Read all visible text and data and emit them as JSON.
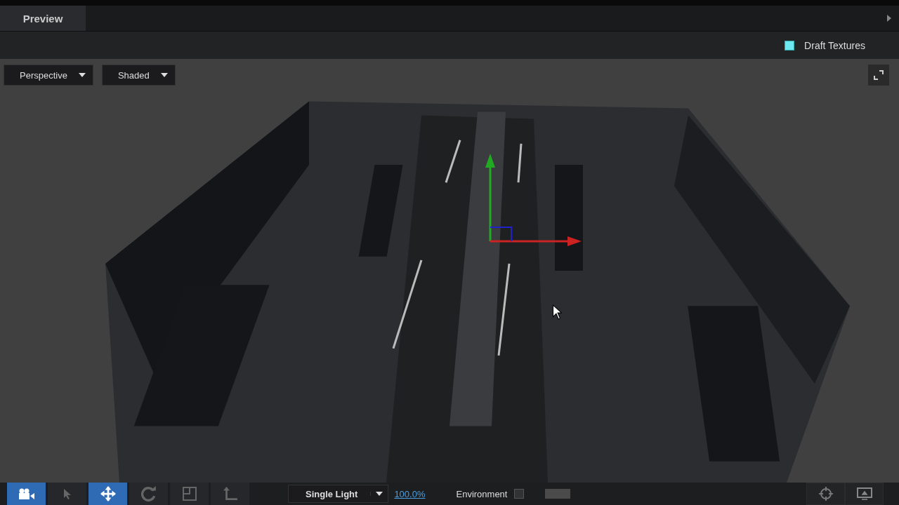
{
  "panel": {
    "title": "Preview"
  },
  "options": {
    "draft_textures": {
      "label": "Draft Textures",
      "checked": true
    }
  },
  "viewport": {
    "view_dropdown": "Perspective",
    "shading_dropdown": "Shaded"
  },
  "toolbar": {
    "tools": [
      {
        "kind": "camera",
        "selected": true
      },
      {
        "kind": "pointer",
        "selected": false
      },
      {
        "kind": "move",
        "selected": true
      },
      {
        "kind": "rotate",
        "selected": false
      },
      {
        "kind": "scale",
        "selected": false
      },
      {
        "kind": "axis",
        "selected": false
      }
    ],
    "lighting_dropdown": "Single Light",
    "zoom_link": "100.0%",
    "environment": {
      "label": "Environment",
      "checked": false
    }
  }
}
